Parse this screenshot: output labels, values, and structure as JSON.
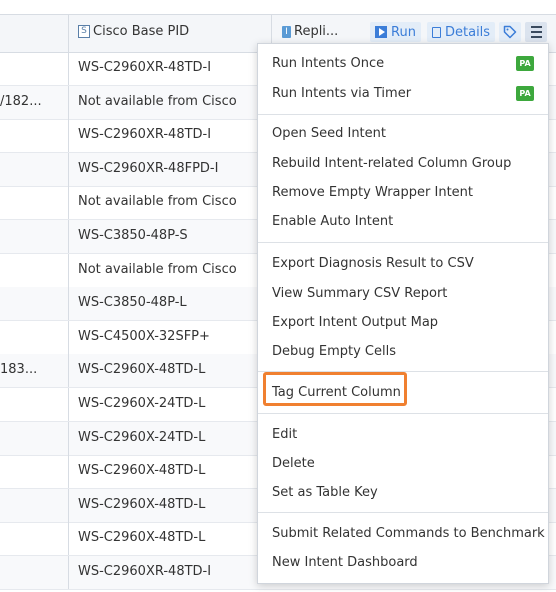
{
  "header": {
    "pid_badge": "S",
    "pid_label": "Cisco Base PID",
    "repl_badge": "I",
    "repl_label": "Repli...",
    "run_label": "Run",
    "details_label": "Details"
  },
  "rows": [
    {
      "left": "",
      "pid": "WS-C2960XR-48TD-I"
    },
    {
      "left": "/182...",
      "pid": "Not available from Cisco"
    },
    {
      "left": "",
      "pid": "WS-C2960XR-48TD-I"
    },
    {
      "left": "",
      "pid": "WS-C2960XR-48FPD-I"
    },
    {
      "left": "",
      "pid": "Not available from Cisco"
    },
    {
      "left": "",
      "pid": "WS-C3850-48P-S"
    },
    {
      "left": "",
      "pid": "Not available from Cisco"
    },
    {
      "left": "",
      "pid": "WS-C3850-48P-L"
    },
    {
      "left": "",
      "pid": "WS-C4500X-32SFP+"
    },
    {
      "left": "183...",
      "pid": "WS-C2960X-48TD-L"
    },
    {
      "left": "",
      "pid": "WS-C2960X-24TD-L"
    },
    {
      "left": "",
      "pid": "WS-C2960X-24TD-L"
    },
    {
      "left": "",
      "pid": "WS-C2960X-48TD-L"
    },
    {
      "left": "",
      "pid": "WS-C2960X-48TD-L"
    },
    {
      "left": "",
      "pid": "WS-C2960X-48TD-L"
    },
    {
      "left": "",
      "pid": "WS-C2960XR-48TD-I"
    }
  ],
  "menu": {
    "pa_badge": "PA",
    "run_once": "Run Intents Once",
    "run_timer": "Run Intents via Timer",
    "open_seed": "Open Seed Intent",
    "rebuild": "Rebuild Intent-related Column Group",
    "remove_wrapper": "Remove Empty Wrapper Intent",
    "enable_auto": "Enable Auto Intent",
    "export_diag": "Export Diagnosis Result to CSV",
    "view_summary": "View Summary CSV Report",
    "export_map": "Export Intent Output Map",
    "debug_cells": "Debug Empty Cells",
    "tag_column": "Tag Current Column",
    "edit": "Edit",
    "delete": "Delete",
    "set_key": "Set as Table Key",
    "submit_bench": "Submit Related Commands to Benchmark",
    "new_dashboard": "New Intent Dashboard"
  },
  "colors": {
    "accent": "#3b7dd8",
    "highlight": "#f08030",
    "pa_green": "#3da83d"
  }
}
